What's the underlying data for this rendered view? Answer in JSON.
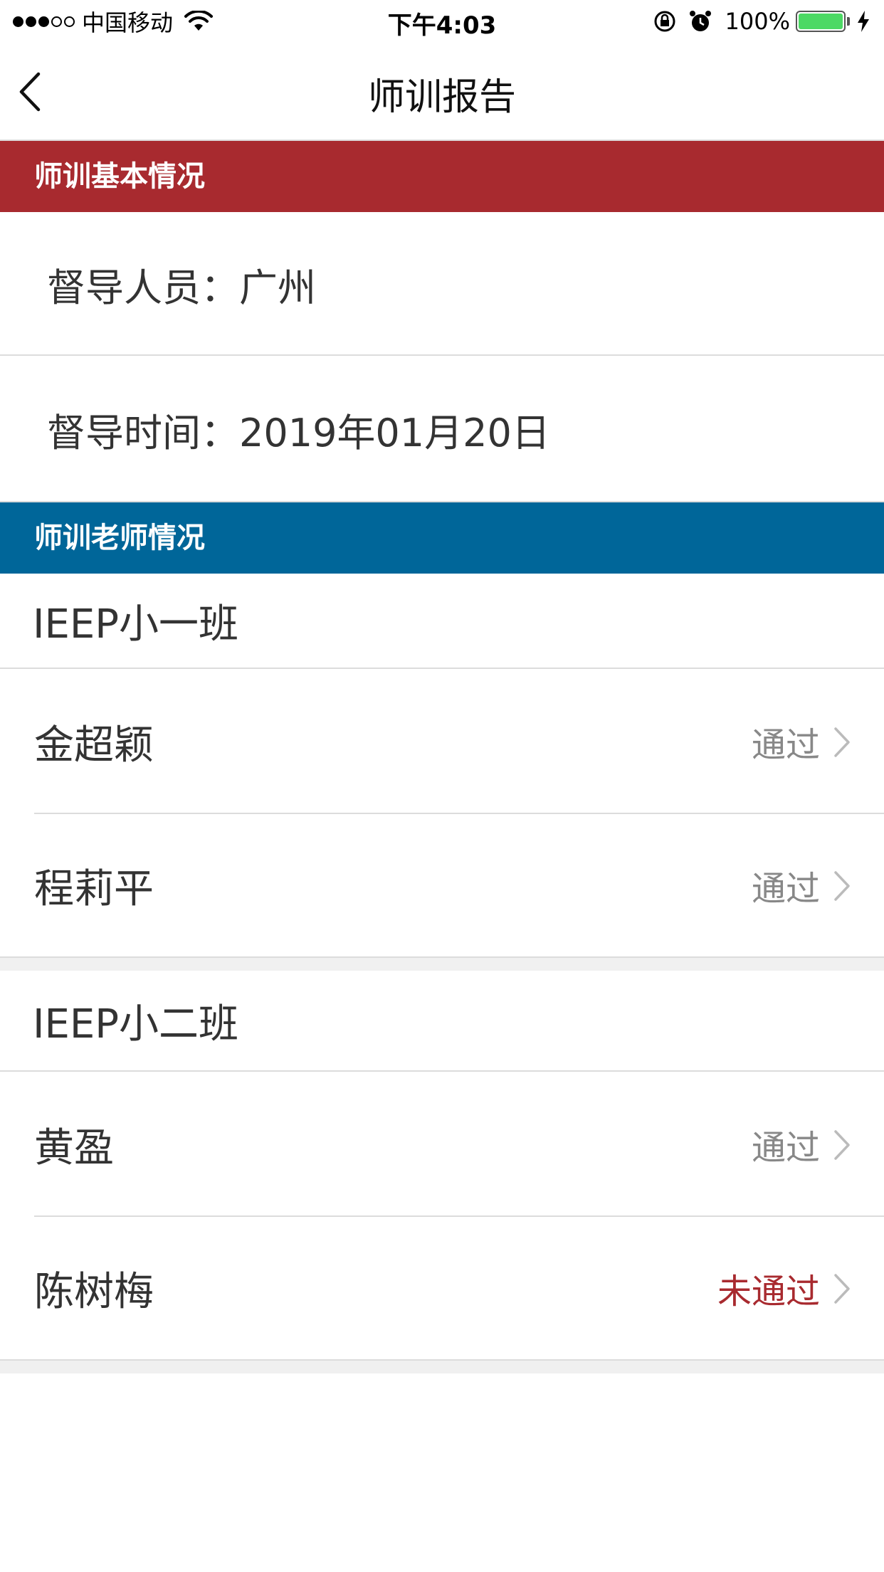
{
  "status_bar": {
    "carrier": "中国移动",
    "time": "下午4:03",
    "battery": "100%",
    "signal_bars_filled": 3,
    "signal_bars_total": 5,
    "battery_level": 1.0,
    "icons": [
      "signal-icon",
      "wifi-icon",
      "rotation-lock-icon",
      "alarm-icon",
      "battery-icon",
      "charging-icon"
    ]
  },
  "nav": {
    "title": "师训报告",
    "back_icon": "chevron-left-icon"
  },
  "colors": {
    "section_basic_bg": "#a82a2f",
    "section_teachers_bg": "#006699",
    "fail_text": "#a82a2f",
    "pass_text": "#888888"
  },
  "basic_info": {
    "header": "师训基本情况",
    "supervisor_label": "督导人员：",
    "supervisor_value": "广州",
    "time_label": "督导时间：",
    "time_value": "2019年01月20日"
  },
  "teachers": {
    "header": "师训老师情况",
    "classes": [
      {
        "name": "IEEP小一班",
        "teachers": [
          {
            "name": "金超颖",
            "status": "通过"
          },
          {
            "name": "程莉平",
            "status": "通过"
          }
        ]
      },
      {
        "name": "IEEP小二班",
        "teachers": [
          {
            "name": "黄盈",
            "status": "通过"
          },
          {
            "name": "陈树梅",
            "status": "未通过"
          }
        ]
      }
    ]
  }
}
